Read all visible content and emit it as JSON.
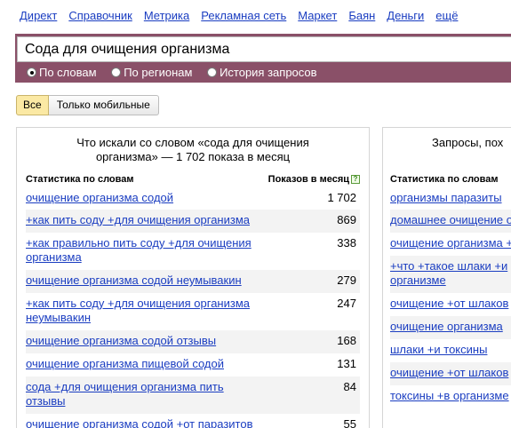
{
  "nav": [
    "Директ",
    "Справочник",
    "Метрика",
    "Рекламная сеть",
    "Маркет",
    "Баян",
    "Деньги",
    "ещё"
  ],
  "search": {
    "value": "Сода для очищения организма"
  },
  "radios": [
    {
      "label": "По словам",
      "checked": true
    },
    {
      "label": "По регионам",
      "checked": false
    },
    {
      "label": "История запросов",
      "checked": false
    }
  ],
  "device_toggle": {
    "all": "Все",
    "mobile": "Только мобильные",
    "active": "all"
  },
  "left_panel": {
    "title": "Что искали со словом «сода для очищения организма» — 1 702 показа в месяц",
    "col_phrase": "Статистика по словам",
    "col_count": "Показов в месяц",
    "help": "?",
    "rows": [
      {
        "phrase": "очищение организма содой",
        "count": "1 702"
      },
      {
        "phrase": "+как пить соду +для очищения организма",
        "count": "869"
      },
      {
        "phrase": "+как правильно пить соду +для очищения организма",
        "count": "338"
      },
      {
        "phrase": "очищение организма содой неумывакин",
        "count": "279"
      },
      {
        "phrase": "+как пить соду +для очищения организма неумывакин",
        "count": "247"
      },
      {
        "phrase": "очищение организма содой отзывы",
        "count": "168"
      },
      {
        "phrase": "очищение организма пищевой содой",
        "count": "131"
      },
      {
        "phrase": "сода +для очищения организма пить отзывы",
        "count": "84"
      },
      {
        "phrase": "очищение организма содой +от паразитов",
        "count": "55"
      }
    ]
  },
  "right_panel": {
    "title": "Запросы, пох",
    "col_phrase": "Статистика по словам",
    "rows": [
      {
        "phrase": "организмы паразиты"
      },
      {
        "phrase": "домашнее очищение о"
      },
      {
        "phrase": "очищение организма +"
      },
      {
        "phrase": "+что +такое шлаки +и",
        "phrase2": "организме"
      },
      {
        "phrase": "очищение +от шлаков"
      },
      {
        "phrase": "очищение организма"
      },
      {
        "phrase": "шлаки +и токсины"
      },
      {
        "phrase": "очищение +от шлаков"
      },
      {
        "phrase": "токсины +в организме"
      }
    ]
  }
}
